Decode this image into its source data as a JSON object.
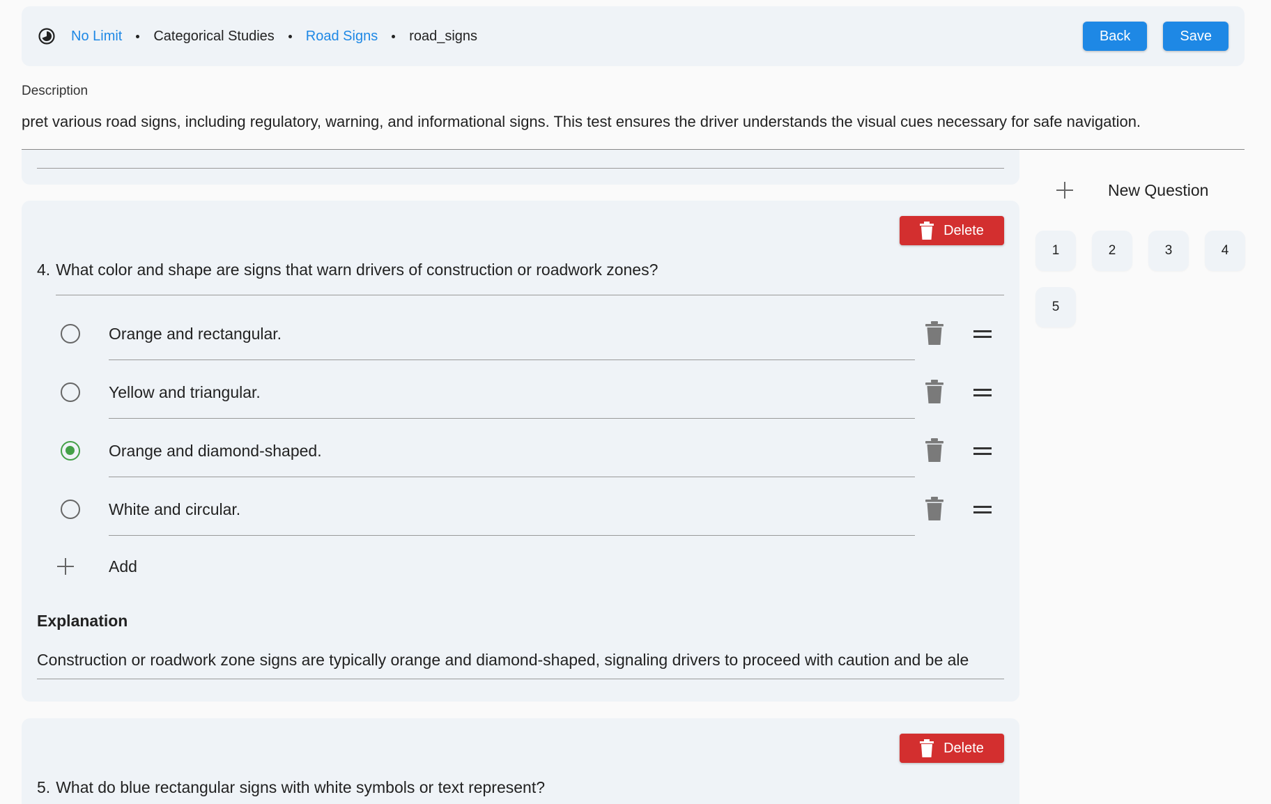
{
  "header": {
    "timer_label": "No Limit",
    "breadcrumb": [
      "Categorical Studies",
      "Road Signs",
      "road_signs"
    ],
    "back_label": "Back",
    "save_label": "Save"
  },
  "description": {
    "label": "Description",
    "value": "pret various road signs, including regulatory, warning, and informational signs. This test ensures the driver understands the visual cues necessary for safe navigation."
  },
  "questions": [
    {
      "number": "4.",
      "text": "What color and shape are signs that warn drivers of construction or roadwork zones?",
      "delete_label": "Delete",
      "options": [
        {
          "text": "Orange and rectangular.",
          "selected": false
        },
        {
          "text": "Yellow and triangular.",
          "selected": false
        },
        {
          "text": "Orange and diamond-shaped.",
          "selected": true
        },
        {
          "text": "White and circular.",
          "selected": false
        }
      ],
      "add_label": "Add",
      "explanation_title": "Explanation",
      "explanation": "Construction or roadwork zone signs are typically orange and diamond-shaped, signaling drivers to proceed with caution and be ale"
    },
    {
      "number": "5.",
      "text": "What do blue rectangular signs with white symbols or text represent?",
      "delete_label": "Delete"
    }
  ],
  "sidebar": {
    "new_question_label": "New Question",
    "question_numbers": [
      "1",
      "2",
      "3",
      "4",
      "5"
    ]
  },
  "colors": {
    "accent": "#1e88e5",
    "danger": "#d32f2f",
    "selected": "#43a047",
    "card": "#eff3f7"
  }
}
